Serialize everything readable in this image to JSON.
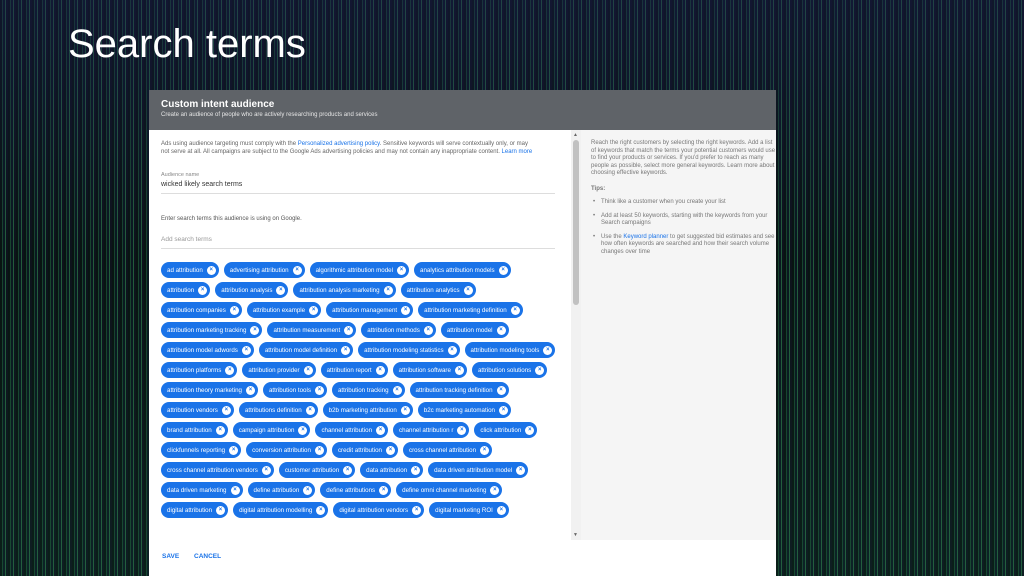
{
  "slide": {
    "title": "Search terms"
  },
  "dialog": {
    "title": "Custom intent audience",
    "subtitle": "Create an audience of people who are actively researching products and services",
    "policy_text_1": "Ads using audience targeting must comply with the ",
    "policy_link": "Personalized advertising policy",
    "policy_text_2": ". Sensitive keywords will serve contextually only, or may not serve at all. All campaigns are subject to the Google Ads advertising policies and may not contain any inappropriate content. ",
    "learn_more": "Learn more",
    "audience_name_label": "Audience name",
    "audience_name_value": "wicked  likely search terms",
    "prompt": "Enter search terms this audience is using on Google.",
    "search_placeholder": "Add search terms",
    "chips": [
      "ad attribution",
      "advertising attribution",
      "algorithmic attribution model",
      "analytics attribution models",
      "attribution",
      "attribution analysis",
      "attribution analysis marketing",
      "attribution analytics",
      "attribution companies",
      "attribution example",
      "attribution management",
      "attribution marketing definition",
      "attribution marketing tracking",
      "attribution measurement",
      "attribution methods",
      "attribution model",
      "attribution model adwords",
      "attribution model definition",
      "attribution modeling statistics",
      "attribution modeling tools",
      "attribution platforms",
      "attribution provider",
      "attribution report",
      "attribution software",
      "attribution solutions",
      "attribution theory marketing",
      "attribution tools",
      "attribution tracking",
      "attribution tracking definition",
      "attribution vendors",
      "attributions definition",
      "b2b marketing attribution",
      "b2c marketing automation",
      "brand attribution",
      "campaign attribution",
      "channel attribution",
      "channel attribution r",
      "click attribution",
      "clickfunnels reporting",
      "conversion attribution",
      "credit attribution",
      "cross channel attribution",
      "cross channel attribution vendors",
      "customer attribution",
      "data attribution",
      "data driven attribution model",
      "data driven marketing",
      "define attribution",
      "define attributions",
      "define omni channel marketing",
      "digital attribution",
      "digital attribution modelling",
      "digital attribution vendors",
      "digital marketing ROI"
    ],
    "save_label": "SAVE",
    "cancel_label": "CANCEL"
  },
  "side_panel": {
    "intro": "Reach the right customers by selecting the right keywords. Add a list of keywords that match the terms your potential customers would use to find your products or services. If you'd prefer to reach as many people as possible, select more general keywords. Learn more about choosing effective keywords.",
    "tips_title": "Tips:",
    "tip_1": "Think like a customer when you create your list",
    "tip_2": "Add at least 50 keywords, starting with the keywords from your Search campaigns",
    "tip_3_pre": "Use the ",
    "tip_3_link": "Keyword planner",
    "tip_3_post": " to get suggested bid estimates and see how often keywords are searched and how their search volume changes over time"
  },
  "colors": {
    "accent": "#1a73e8",
    "header": "#5f6368"
  }
}
